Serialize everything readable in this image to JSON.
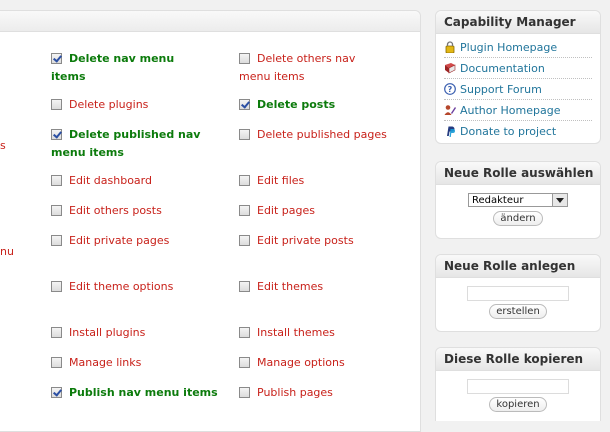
{
  "capabilities": [
    {
      "label": "Delete nav menu items",
      "checked": true
    },
    {
      "label": "Delete others nav menu items",
      "checked": false
    },
    {
      "label": "Delete plugins",
      "checked": false
    },
    {
      "label": "Delete posts",
      "checked": true
    },
    {
      "label": "Delete published nav menu items",
      "checked": true
    },
    {
      "label": "Delete published pages",
      "checked": false
    },
    {
      "label": "Edit dashboard",
      "checked": false
    },
    {
      "label": "Edit files",
      "checked": false
    },
    {
      "label": "Edit others posts",
      "checked": false
    },
    {
      "label": "Edit pages",
      "checked": false
    },
    {
      "label": "Edit private pages",
      "checked": false
    },
    {
      "label": "Edit private posts",
      "checked": false
    },
    {
      "label": "Edit theme options",
      "checked": false
    },
    {
      "label": "Edit themes",
      "checked": false
    },
    {
      "label": "Install plugins",
      "checked": false
    },
    {
      "label": "Install themes",
      "checked": false
    },
    {
      "label": "Manage links",
      "checked": false
    },
    {
      "label": "Manage options",
      "checked": false
    },
    {
      "label": "Publish nav menu items",
      "checked": true
    },
    {
      "label": "Publish pages",
      "checked": false
    }
  ],
  "edge": {
    "s": "s",
    "nu": "nu"
  },
  "sidebar": {
    "manager": {
      "title": "Capability Manager",
      "links": [
        {
          "label": "Plugin Homepage",
          "icon": "lock-icon"
        },
        {
          "label": "Documentation",
          "icon": "book-icon"
        },
        {
          "label": "Support Forum",
          "icon": "help-icon"
        },
        {
          "label": "Author Homepage",
          "icon": "author-icon"
        },
        {
          "label": "Donate to project",
          "icon": "paypal-icon"
        }
      ]
    },
    "select_role": {
      "title": "Neue Rolle auswählen",
      "selected": "Redakteur",
      "button": "ändern"
    },
    "new_role": {
      "title": "Neue Rolle anlegen",
      "button": "erstellen"
    },
    "copy_role": {
      "title": "Diese Rolle kopieren",
      "button": "kopieren"
    }
  }
}
